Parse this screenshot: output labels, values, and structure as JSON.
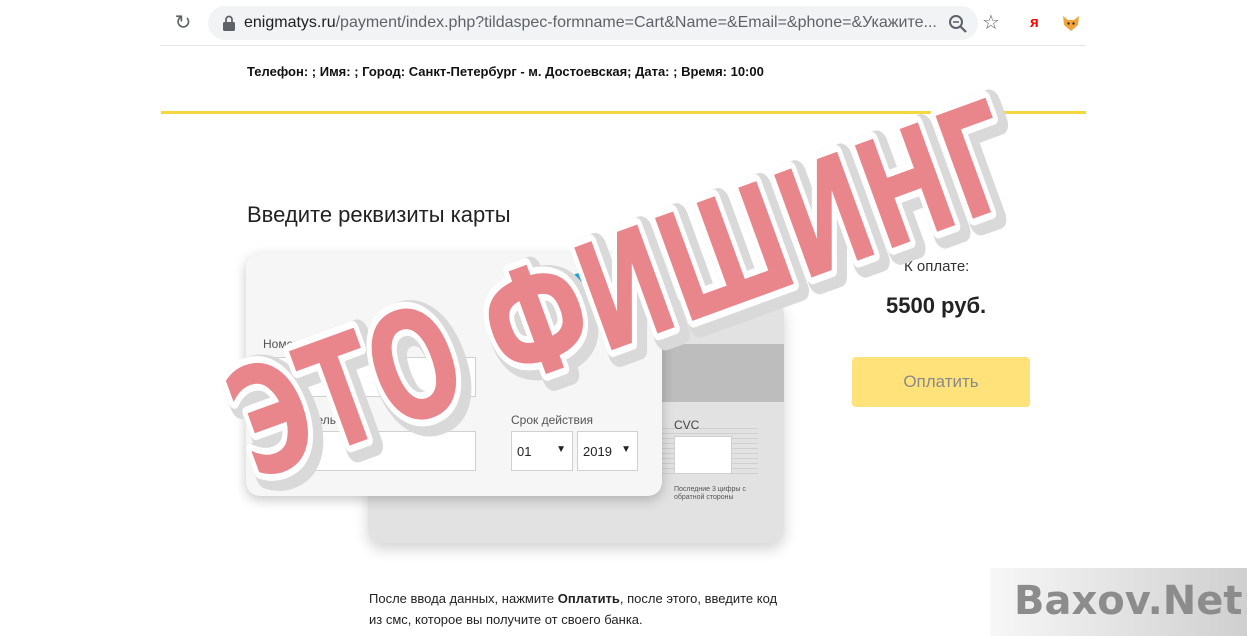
{
  "browser": {
    "url_host": "enigmatys.ru",
    "url_path": "/payment/index.php?tildaspec-formname=Cart&Name=&Email=&phone=&Укажите..."
  },
  "order_info": "Телефон: ; Имя: ; Город: Санкт-Петербург - м. Достоевская; Дата: ; Время: 10:00",
  "form": {
    "heading": "Введите реквизиты карты",
    "brand_visa": "VISA",
    "card_number_label": "Номер карты",
    "holder_label": "Имя владельца",
    "expiry_label": "Срок действия",
    "month_value": "01",
    "year_value": "2019",
    "cvc_label": "CVC",
    "cvc_hint": "Последние 3 цифры с обратной стороны"
  },
  "payment": {
    "label": "К оплате:",
    "amount": "5500 руб.",
    "button": "Оплатить"
  },
  "footnote": {
    "before": "После ввода данных, нажмите ",
    "bold": "Оплатить",
    "after": ", после этого, введите код из смс, которое вы получите от своего банка."
  },
  "overlay": {
    "stamp_text": "ЭТО ФИШИНГ",
    "stamp_color": "#e9868c",
    "watermark": "Baxov.Net"
  },
  "colors": {
    "accent_yellow": "#f5d83f",
    "button_yellow": "#ffe27a"
  }
}
